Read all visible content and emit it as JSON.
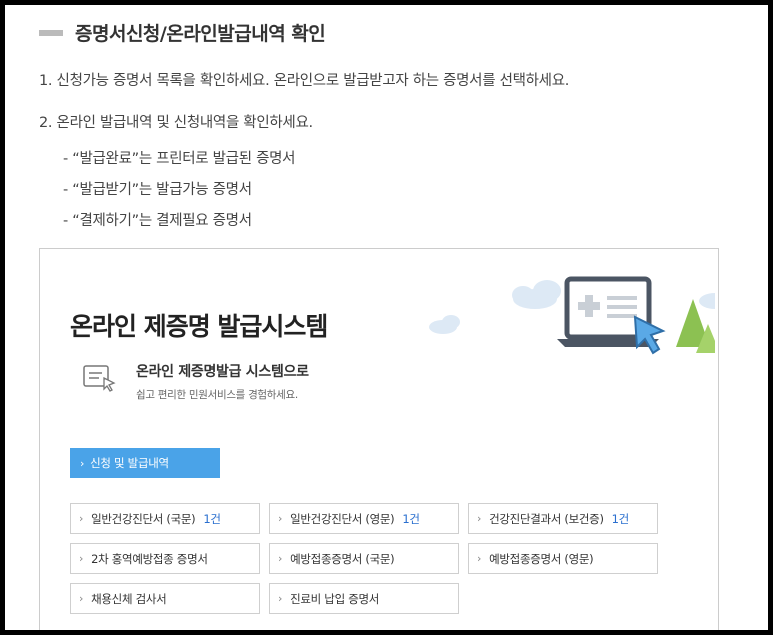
{
  "section_title": "증명서신청/온라인발급내역 확인",
  "steps": [
    "1. 신청가능 증명서 목록을 확인하세요. 온라인으로 발급받고자 하는 증명서를 선택하세요.",
    "2. 온라인 발급내역 및 신청내역을 확인하세요."
  ],
  "sub_items": [
    "- “발급완료”는 프린터로 발급된 증명서",
    "- “발급받기”는 발급가능 증명서",
    "- “결제하기”는 결제필요 증명서"
  ],
  "system": {
    "title": "온라인 제증명 발급시스템",
    "subtitle": "온라인 제증명발급 시스템으로",
    "description": "쉽고 편리한 민원서비스를 경험하세요.",
    "apply_button": "신청 및 발급내역"
  },
  "certificates": [
    {
      "label": "일반건강진단서 (국문)",
      "count": "1건"
    },
    {
      "label": "일반건강진단서 (영문)",
      "count": "1건"
    },
    {
      "label": "건강진단결과서 (보건증)",
      "count": "1건"
    },
    {
      "label": "2차 홍역예방접종 증명서",
      "count": ""
    },
    {
      "label": "예방접종증명서 (국문)",
      "count": ""
    },
    {
      "label": "예방접종증명서 (영문)",
      "count": ""
    },
    {
      "label": "채용신체 검사서",
      "count": ""
    },
    {
      "label": "진료비 납입 증명서",
      "count": ""
    }
  ],
  "colors": {
    "accent_blue": "#4aa3e8",
    "count_blue": "#2a6fcf",
    "tree_green": "#8cc152",
    "cloud": "#dde9f5"
  },
  "icons": {
    "subtitle_icon": "document-pointer-icon",
    "illustration": "laptop-cursor-illustration",
    "chevron": "chevron-right-icon"
  }
}
